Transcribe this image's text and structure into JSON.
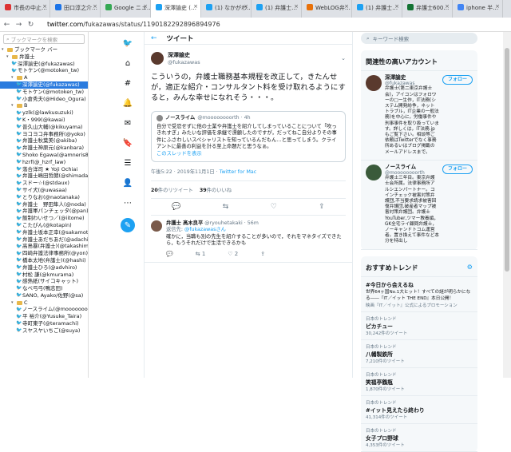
{
  "tabs": [
    {
      "label": "市長の中止…",
      "color": "#d33"
    },
    {
      "label": "田口淳之介…",
      "color": "#1a73e8"
    },
    {
      "label": "Google ニュ…",
      "color": "#34a853"
    },
    {
      "label": "深澤諭史 (…",
      "color": "#1da1f2"
    },
    {
      "label": "(1) なかがわ…",
      "color": "#1da1f2"
    },
    {
      "label": "(1) 弁護士…",
      "color": "#1da1f2"
    },
    {
      "label": "WebLOG弁…",
      "color": "#e8710a"
    },
    {
      "label": "(1) 弁護士…",
      "color": "#1da1f2"
    },
    {
      "label": "弁護士600…",
      "color": "#137333"
    },
    {
      "label": "iphone 半…",
      "color": "#4285f4"
    }
  ],
  "address": {
    "url_prefix": "twitter.com",
    "url_path": "/fukazawas/status/1190182292896894976"
  },
  "sidebar": {
    "search_placeholder": "ブックマークを検索",
    "items": [
      {
        "label": "ブックマーク バー",
        "type": "folder",
        "depth": 0
      },
      {
        "label": "弁護士",
        "type": "folder",
        "depth": 1
      },
      {
        "label": "深澤諭史(@fukazawas)",
        "type": "bird",
        "depth": 2
      },
      {
        "label": "モトケン(@motoken_tw)",
        "type": "bird",
        "depth": 2
      },
      {
        "label": "A",
        "type": "folder",
        "depth": 2
      },
      {
        "label": "深澤諭史(@fukazawas)",
        "type": "bird",
        "depth": 3,
        "selected": true
      },
      {
        "label": "モトケン(@motoken_tw)",
        "type": "bird",
        "depth": 3
      },
      {
        "label": "小倉秀夫(@Hideo_Ogura)",
        "type": "bird",
        "depth": 3
      },
      {
        "label": "B",
        "type": "folder",
        "depth": 2
      },
      {
        "label": "yzlk(@lawkusuzuki)",
        "type": "bird",
        "depth": 3
      },
      {
        "label": "K・999(@kawai)",
        "type": "bird",
        "depth": 3
      },
      {
        "label": "普久山大輔(@kikuyama)",
        "type": "bird",
        "depth": 3
      },
      {
        "label": "ヨコヨコ弁事務所(@yoko)",
        "type": "bird",
        "depth": 3
      },
      {
        "label": "弁護士秋葉美(@akiba)",
        "type": "bird",
        "depth": 3
      },
      {
        "label": "弁護士神原元(@kanbara)",
        "type": "bird",
        "depth": 3
      },
      {
        "label": "Shoko Egawa(@amneris84)",
        "type": "bird",
        "depth": 3
      },
      {
        "label": "hzrf(@_hzrf_law)",
        "type": "bird",
        "depth": 3
      },
      {
        "label": "落合洋司 ★ Yoji Ochiai",
        "type": "bird",
        "depth": 3
      },
      {
        "label": "弁護士嶋田哲朗(@shimada)",
        "type": "bird",
        "depth": 3
      },
      {
        "label": "スドー☆(@stdaux)",
        "type": "bird",
        "depth": 3
      },
      {
        "label": "サイ犬(@uwasaa)",
        "type": "bird",
        "depth": 3
      },
      {
        "label": "とりなお(@naotanaka)",
        "type": "bird",
        "depth": 3
      },
      {
        "label": "弁護士　野田隼人(@noda)",
        "type": "bird",
        "depth": 3
      },
      {
        "label": "弁護軍パンチェッタ(@pan)",
        "type": "bird",
        "depth": 3
      },
      {
        "label": "飯制わいせつ／(@iitome)",
        "type": "bird",
        "depth": 3
      },
      {
        "label": "こたぴん(@kotapin)",
        "type": "bird",
        "depth": 3
      },
      {
        "label": "弁護士坂本正幸(@sakamoto)",
        "type": "bird",
        "depth": 3
      },
      {
        "label": "弁護士あだちあだ(@adachi)",
        "type": "bird",
        "depth": 3
      },
      {
        "label": "高島暴(弁護士)(@takashima)",
        "type": "bird",
        "depth": 3
      },
      {
        "label": "四崎弁護法律事務所(@yon)",
        "type": "bird",
        "depth": 3
      },
      {
        "label": "橋本太地(弁護士)(@hashi)",
        "type": "bird",
        "depth": 3
      },
      {
        "label": "弁護士ひろ(@advhiro)",
        "type": "bird",
        "depth": 3
      },
      {
        "label": "村松 謙(@kmurama)",
        "type": "bird",
        "depth": 3
      },
      {
        "label": "感熱紙(サイコキャット)",
        "type": "bird",
        "depth": 3
      },
      {
        "label": "なべ弓弓(鴨志田)",
        "type": "bird",
        "depth": 3
      },
      {
        "label": "SANO, Ayako/佐野(@sa)",
        "type": "bird",
        "depth": 3
      },
      {
        "label": "C",
        "type": "folder",
        "depth": 2
      },
      {
        "label": "ノースライム(@moooooooorth)",
        "type": "bird",
        "depth": 3
      },
      {
        "label": "平 裕介(@Yusuke_Taira)",
        "type": "bird",
        "depth": 3
      },
      {
        "label": "寺町東子(@teramachi)",
        "type": "bird",
        "depth": 3
      },
      {
        "label": "スヤスヤいちご(@suya)",
        "type": "bird",
        "depth": 3
      }
    ]
  },
  "leftnav": [
    {
      "icon": "twitter-logo-icon",
      "glyph": "🐦"
    },
    {
      "icon": "home-icon",
      "glyph": "⌂"
    },
    {
      "icon": "hashtag-icon",
      "glyph": "#"
    },
    {
      "icon": "bell-icon",
      "glyph": "🔔"
    },
    {
      "icon": "mail-icon",
      "glyph": "✉"
    },
    {
      "icon": "bookmark-icon",
      "glyph": "🔖"
    },
    {
      "icon": "list-icon",
      "glyph": "☰"
    },
    {
      "icon": "profile-icon",
      "glyph": "👤"
    },
    {
      "icon": "more-icon",
      "glyph": "⋯"
    },
    {
      "icon": "compose-icon",
      "glyph": "✎"
    }
  ],
  "main": {
    "header_title": "ツイート",
    "tweet": {
      "author_name": "深澤諭史",
      "author_handle": "@fukazawas",
      "body": "こういうの，弁護士職務基本規程を改正して，きたんせが，適正な紹介・コンサルタント料を受け取れるようにすると，みんな幸せになれそう・・・。",
      "quote": {
        "name": "ノースライム",
        "handle": "@moooooooorth · 4h",
        "text": "自分で受忍せずに他の士業や弁護士を紹介してしまっていることについて「吹っきれすぎ」みたいな評価を承継で漂顧したのですが，だってねこ自分よりその事件にふさわしいスペシャリストを知っているんだもん…と思ってしまう。クライアントに最善の利益を計る至上命題だと思うなぁ。",
        "link": "このスレッドを表示"
      },
      "timestamp": "午後5:22 · 2019年11月1日 · ",
      "via": "Twitter for Mac",
      "retweets_count": "20",
      "retweets_label": "件のリツイート",
      "likes_count": "39",
      "likes_label": "件のいいね"
    },
    "reply": {
      "name": "弁護士 髙木良平",
      "handle": "@ryouhetakaki · 56m",
      "to_prefix": "返信先: ",
      "to_handle": "@fukazawasさん",
      "text": "確かに，当職も別の先生を紹介することが多いので，それをマネタイズできたら，もうそれだけで生活できるかも",
      "retweets": "1",
      "likes": "2"
    }
  },
  "right": {
    "search_placeholder": "キーワード検索",
    "related_title": "関連性の高いアカウント",
    "follow_label": "フォロー",
    "accounts": [
      {
        "name": "深澤諭史",
        "handle": "@fukazawas",
        "bio": "弁護士(第二東京弁護士会)，アイコンはフォロワーの□ー生作，IT法務(システム開発紛争，ネットトラブル，IT企業の一般法務)を中心に，労働事件や刑事事件を取り扱っています。詳しくは，IT法務.jp もご覧下さい。相談等ご依頼はTwitterでなく事務所あるいはブログ掲載のメールアドレスまで。",
        "color": "#5a3a2e"
      },
      {
        "name": "ノースライム",
        "handle": "@moooooooorth",
        "bio": "弁護士三年目。東京弁護士会所属。法律事務所アルシエンパートナー。コインチェック被害対策弁護団,不当要求請求被害回復弁護団,破産者マップ被害対策弁護団。弁護士YouTuber,ツマー教養編，GK全宅ライ顧問弁護士，ノーキャンドトコム運営者。置き換えて事件など本分を特出し",
        "color": "#3a5a3a"
      }
    ],
    "trends_title": "おすすめトレンド",
    "trends": [
      {
        "category": "",
        "name": "#今日から会えるね",
        "desc": "世界64ヶ国No.1大ヒット！すべての謎が明らかになる――『IT／イット THE END』本日公開！",
        "count": "",
        "promo": "映画『IT／イット』公式によるプロモーション"
      },
      {
        "category": "日本のトレンド",
        "name": "ピカチュー",
        "desc": "",
        "count": "30,242件のツイート",
        "promo": ""
      },
      {
        "category": "日本のトレンド",
        "name": "八幡製鉄所",
        "desc": "",
        "count": "7,210件のツイート",
        "promo": ""
      },
      {
        "category": "日本のトレンド",
        "name": "笑福亭鶴瓶",
        "desc": "",
        "count": "1,870件のツイート",
        "promo": ""
      },
      {
        "category": "日本のトレンド",
        "name": "#イット見えたら終わり",
        "desc": "",
        "count": "41,314件のツイート",
        "promo": ""
      },
      {
        "category": "日本のトレンド",
        "name": "女子プロ野球",
        "desc": "",
        "count": "4,353件のツイート",
        "promo": ""
      }
    ]
  }
}
